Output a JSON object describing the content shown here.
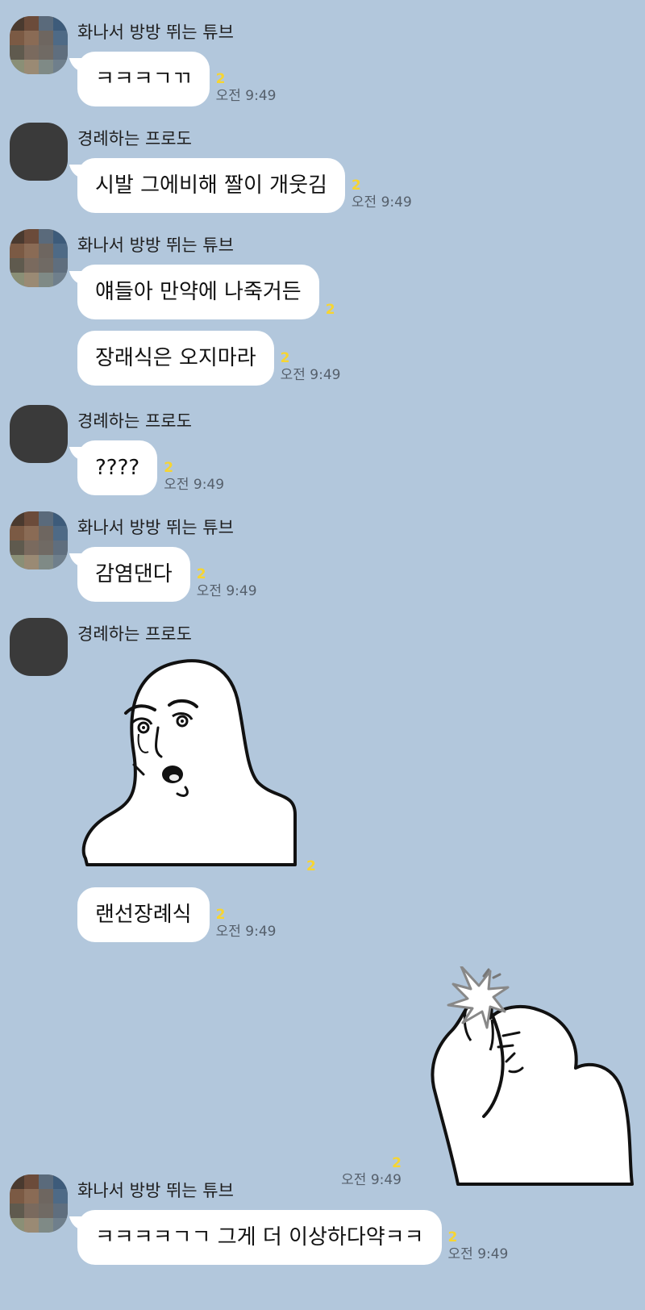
{
  "colors": {
    "background": "#b2c7dc",
    "bubble": "#ffffff",
    "unread": "#f7d531"
  },
  "users": {
    "tube": "화나서 방방 뛰는 튜브",
    "frodo": "경례하는 프로도"
  },
  "messages": {
    "m1": {
      "text": "ㅋㅋㅋㄱㄲ",
      "unread": "2",
      "time": "오전 9:49"
    },
    "m2": {
      "text": "시발 그에비해 짤이 개웃김",
      "unread": "2",
      "time": "오전 9:49"
    },
    "m3": {
      "text": "얘들아 만약에 나죽거든",
      "unread": "2"
    },
    "m4": {
      "text": "장래식은 오지마라",
      "unread": "2",
      "time": "오전 9:49"
    },
    "m5": {
      "text": "????",
      "unread": "2",
      "time": "오전 9:49"
    },
    "m6": {
      "text": "감염댄다",
      "unread": "2",
      "time": "오전 9:49"
    },
    "m7": {
      "sticker": "shocked-face-sticker",
      "unread": "2"
    },
    "m8": {
      "text": "랜선장례식",
      "unread": "2",
      "time": "오전 9:49"
    },
    "m9": {
      "sticker": "facepalm-sticker",
      "unread": "2",
      "time": "오전 9:49"
    },
    "m10": {
      "text": "ㅋㅋㅋㅋㄱㄱ 그게 더 이상하다약ㅋㅋ",
      "unread": "2",
      "time": "오전 9:49"
    }
  }
}
